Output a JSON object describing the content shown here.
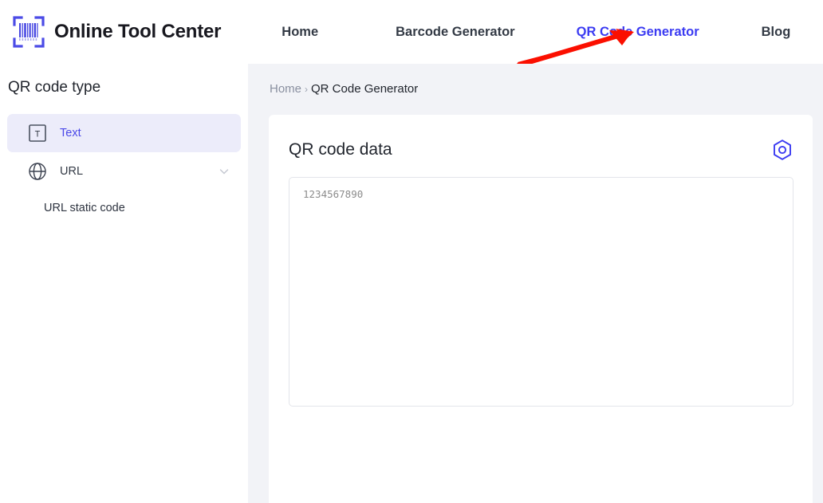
{
  "header": {
    "logo_text": "Online Tool Center",
    "logo_icon": "barcode-scanner-icon",
    "nav": [
      {
        "label": "Home",
        "active": false
      },
      {
        "label": "Barcode Generator",
        "active": false
      },
      {
        "label": "QR Code Generator",
        "active": true
      },
      {
        "label": "Blog",
        "active": false
      }
    ]
  },
  "annotation": {
    "type": "red-arrow",
    "color": "#fb0f00",
    "points_to": "QR Code Generator"
  },
  "sidebar": {
    "title": "QR code type",
    "items": [
      {
        "label": "Text",
        "icon": "text-box-icon",
        "active": true,
        "chevron": false
      },
      {
        "label": "URL",
        "icon": "globe-icon",
        "active": false,
        "chevron": true
      }
    ],
    "sub_items": [
      {
        "label": "URL static code"
      }
    ]
  },
  "breadcrumb": {
    "home": "Home",
    "separator": "›",
    "current": "QR Code Generator"
  },
  "main": {
    "card_title": "QR code data",
    "settings_icon": "hexagon-target-icon",
    "textarea_value": "1234567890",
    "textarea_placeholder": "1234567890"
  },
  "colors": {
    "accent": "#3b3bf2",
    "active_item_text": "#4a48e8",
    "active_item_bg": "#ececfa",
    "page_bg": "#f2f3f7",
    "arrow_red": "#fb0f00"
  }
}
